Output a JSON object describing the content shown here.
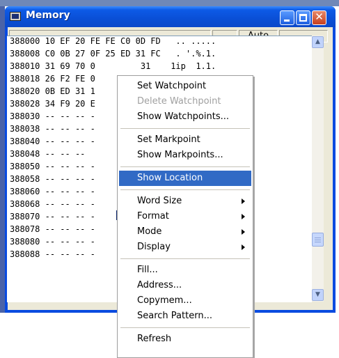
{
  "window": {
    "title": "Memory"
  },
  "toolbar": {
    "mode": "Auto"
  },
  "memory": {
    "rows": [
      {
        "addr": "388000",
        "text": "10 EF 20 FE FE C0 0D FD   .. ....."
      },
      {
        "addr": "388008",
        "text": "C0 0B 27 0F 25 ED 31 FC   . '.%.1."
      },
      {
        "addr": "388010",
        "text": "31 69 70 0         31    1ip  1.1."
      },
      {
        "addr": "388018",
        "text": "26 F2 FE 0               &.    .1'"
      },
      {
        "addr": "388020",
        "text": "0B ED 31 1               ..1    0p."
      },
      {
        "addr": "388028",
        "text": "34 F9 20 E               4. ---  ---"
      },
      {
        "addr": "388030",
        "text": "-- -- -- -               ---   ----"
      },
      {
        "addr": "388038",
        "text": "-- -- -- -               ---   ----"
      },
      {
        "addr": "388040",
        "text": "-- -- -- -               ---   ----"
      },
      {
        "addr": "388048",
        "text": "-- -- --                 ---   ----"
      },
      {
        "addr": "388050",
        "text": "-- -- -- -               ---   ----"
      },
      {
        "addr": "388058",
        "text": "-- -- -- -               ---   ----"
      },
      {
        "addr": "388060",
        "text": "-- -- -- -               ---   ----"
      },
      {
        "addr": "388068",
        "text": "-- -- -- -               ---   ----"
      },
      {
        "addr": "388070",
        "text": "-- -- -- -               ---   ----"
      },
      {
        "addr": "388078",
        "text": "-- -- -- -               ---   ----"
      },
      {
        "addr": "388080",
        "text": "-- -- -- -               ---   ----"
      },
      {
        "addr": "388088",
        "text": "-- -- -- -               ---   ----"
      }
    ]
  },
  "context_menu": {
    "items": [
      {
        "label": "Set Watchpoint"
      },
      {
        "label": "Delete Watchpoint",
        "disabled": true
      },
      {
        "label": "Show Watchpoints..."
      },
      {
        "label": "Set Markpoint"
      },
      {
        "label": "Show Markpoints..."
      },
      {
        "label": "Show Location",
        "highlighted": true
      },
      {
        "label": "Word Size",
        "submenu": true
      },
      {
        "label": "Format",
        "submenu": true
      },
      {
        "label": "Mode",
        "submenu": true
      },
      {
        "label": "Display",
        "submenu": true
      },
      {
        "label": "Fill..."
      },
      {
        "label": "Address..."
      },
      {
        "label": "Copymem..."
      },
      {
        "label": "Search Pattern..."
      },
      {
        "label": "Refresh"
      }
    ]
  },
  "colors": {
    "titlebar": "#0a4fd6",
    "highlight": "#316ac5"
  }
}
